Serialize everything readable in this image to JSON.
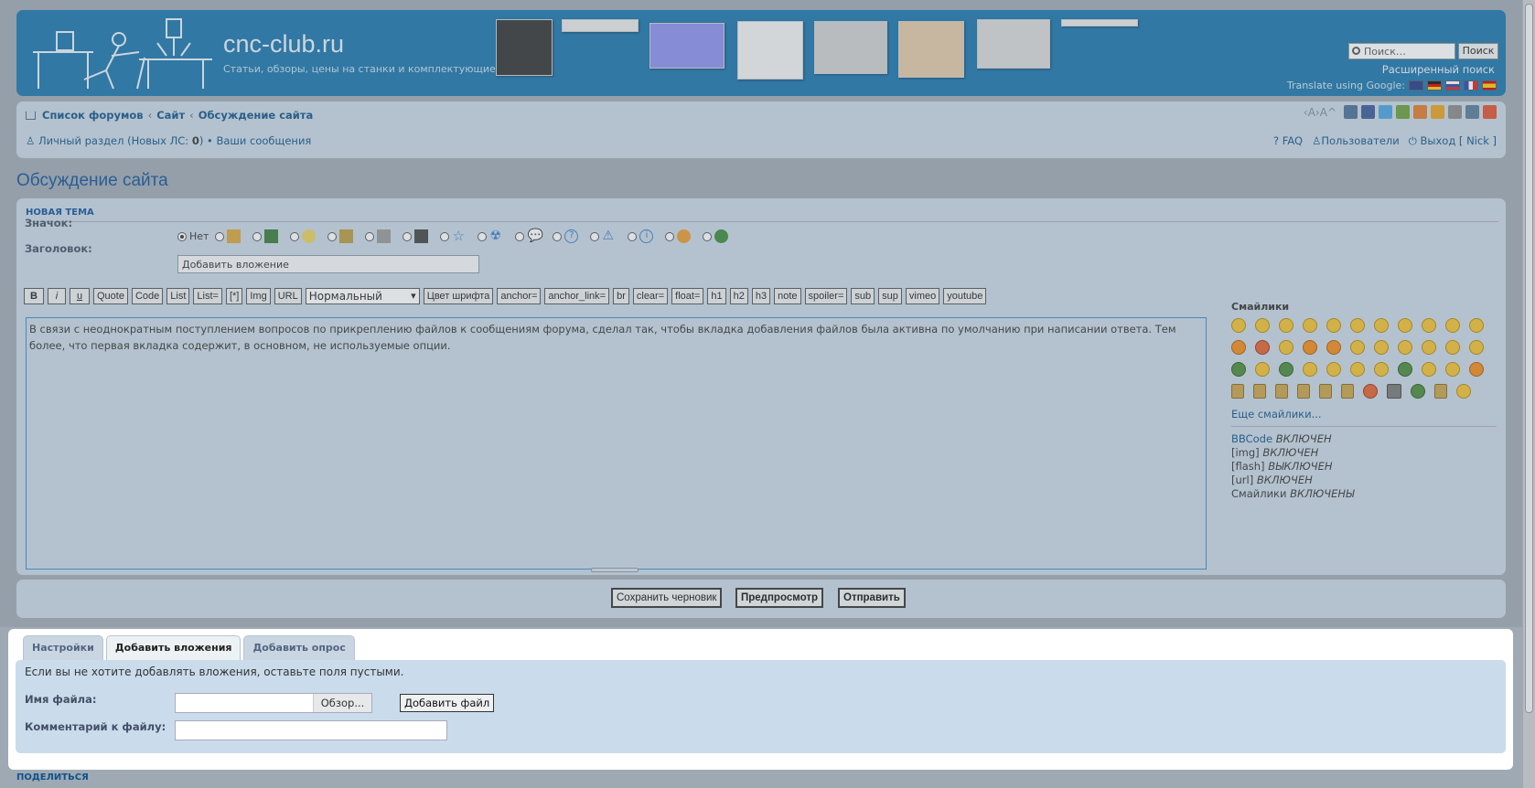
{
  "header": {
    "site_title": "cnc-club.ru",
    "site_desc": "Статьи, обзоры, цены на станки и комплектующие.",
    "search_placeholder": "Поиск…",
    "search_button": "Поиск",
    "advanced_search": "Расширенный поиск",
    "translate_label": "Translate using Google:"
  },
  "nav": {
    "crumbs": [
      "Список форумов",
      "Сайт",
      "Обсуждение сайта"
    ],
    "crumb_sep": "‹",
    "font_size_ctrl": "‹A›A^",
    "personal": "Личный раздел (Новых ЛС: ",
    "new_pm_count": "0",
    "personal_end": ")",
    "bullet": "•",
    "your_messages": "Ваши сообщения",
    "faq": "FAQ",
    "users": "Пользователи",
    "logout": "Выход [ Nick ]"
  },
  "page": {
    "title": "Обсуждение сайта"
  },
  "form": {
    "section": "НОВАЯ ТЕМА",
    "icon_label": "Значок:",
    "icon_none": "Нет",
    "subject_label": "Заголовок:",
    "subject_value": "Добавить вложение",
    "toolbar": [
      "B",
      "i",
      "u",
      "Quote",
      "Code",
      "List",
      "List=",
      "[*]",
      "Img",
      "URL"
    ],
    "font_select": "Нормальный",
    "toolbar2": [
      "Цвет шрифта",
      "anchor=",
      "anchor_link=",
      "br",
      "clear=",
      "float=",
      "h1",
      "h2",
      "h3",
      "note",
      "spoiler=",
      "sub",
      "sup",
      "vimeo",
      "youtube"
    ],
    "message": "В связи с неоднократным поступлением вопросов по прикреплению файлов к сообщениям форума, сделал так, чтобы вкладка добавления файлов была активна по умолчанию при написании ответа. Тем более, что первая вкладка содержит, в основном,  не используемые опции.",
    "smilies_title": "Смайлики",
    "more_smilies": "Еще смайлики...",
    "bbcode_link": "BBCode",
    "bbcode_state": "ВКЛЮЧЕН",
    "img_tag": "[img]",
    "img_state": "ВКЛЮЧЕН",
    "flash_tag": "[flash]",
    "flash_state": "ВЫКЛЮЧЕН",
    "url_tag": "[url]",
    "url_state": "ВКЛЮЧЕН",
    "smilies_tag": "Смайлики",
    "smilies_state": "ВКЛЮЧЕНЫ",
    "save_draft": "Сохранить черновик",
    "preview": "Предпросмотр",
    "submit": "Отправить"
  },
  "attachments": {
    "tabs": [
      "Настройки",
      "Добавить вложения",
      "Добавить опрос"
    ],
    "info": "Если вы не хотите добавлять вложения, оставьте поля пустыми.",
    "filename_label": "Имя файла:",
    "browse": "Обзор...",
    "add_file": "Добавить файл",
    "comment_label": "Комментарий к файлу:"
  },
  "footer": {
    "share": "ПОДЕЛИТЬСЯ"
  },
  "colors": {
    "header_bg": "#1a74ad",
    "panel_bg": "#c7d7e4",
    "link": "#105289",
    "attach_bg": "#cadceb"
  }
}
